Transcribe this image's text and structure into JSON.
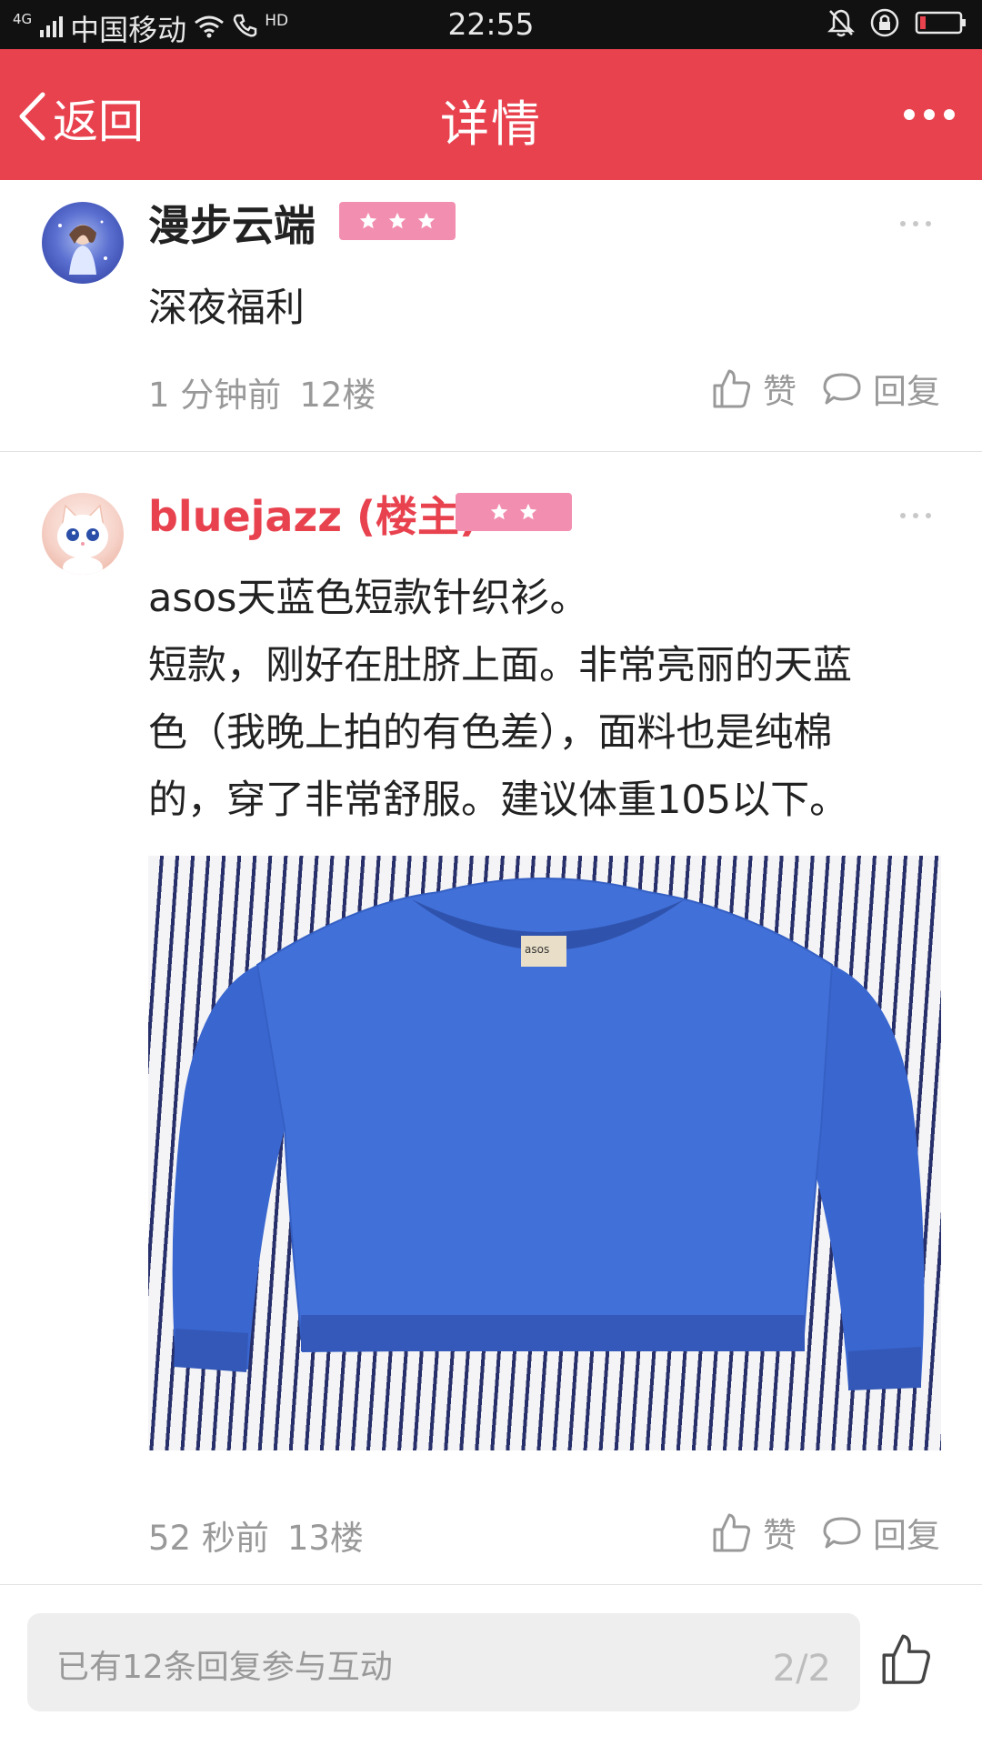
{
  "status_bar": {
    "network": "4G",
    "carrier": "中国移动",
    "hd": "HD",
    "time": "22:55"
  },
  "header": {
    "back_label": "返回",
    "title": "详情"
  },
  "posts": [
    {
      "username": "漫步云端",
      "badge_stars": 3,
      "text": "深夜福利",
      "time": "1 分钟前",
      "floor": "12楼",
      "like_label": "赞",
      "reply_label": "回复"
    },
    {
      "username": "bluejazz (楼主)",
      "badge_stars": 2,
      "text_lines": [
        "asos天蓝色短款针织衫。",
        "短款，刚好在肚脐上面。非常亮丽的天蓝",
        "色（我晚上拍的有色差），面料也是纯棉",
        "的，穿了非常舒服。建议体重105以下。"
      ],
      "photo_tag": "asos",
      "time": "52 秒前",
      "floor": "13楼",
      "like_label": "赞",
      "reply_label": "回复"
    }
  ],
  "bottom": {
    "reply_placeholder": "已有12条回复参与互动",
    "page_indicator": "2/2"
  },
  "colors": {
    "header": "#e8424f",
    "owner_name": "#e8424f",
    "badge": "#f28fb0",
    "meta_text": "#999999",
    "sweater": "#3f6fd6"
  }
}
